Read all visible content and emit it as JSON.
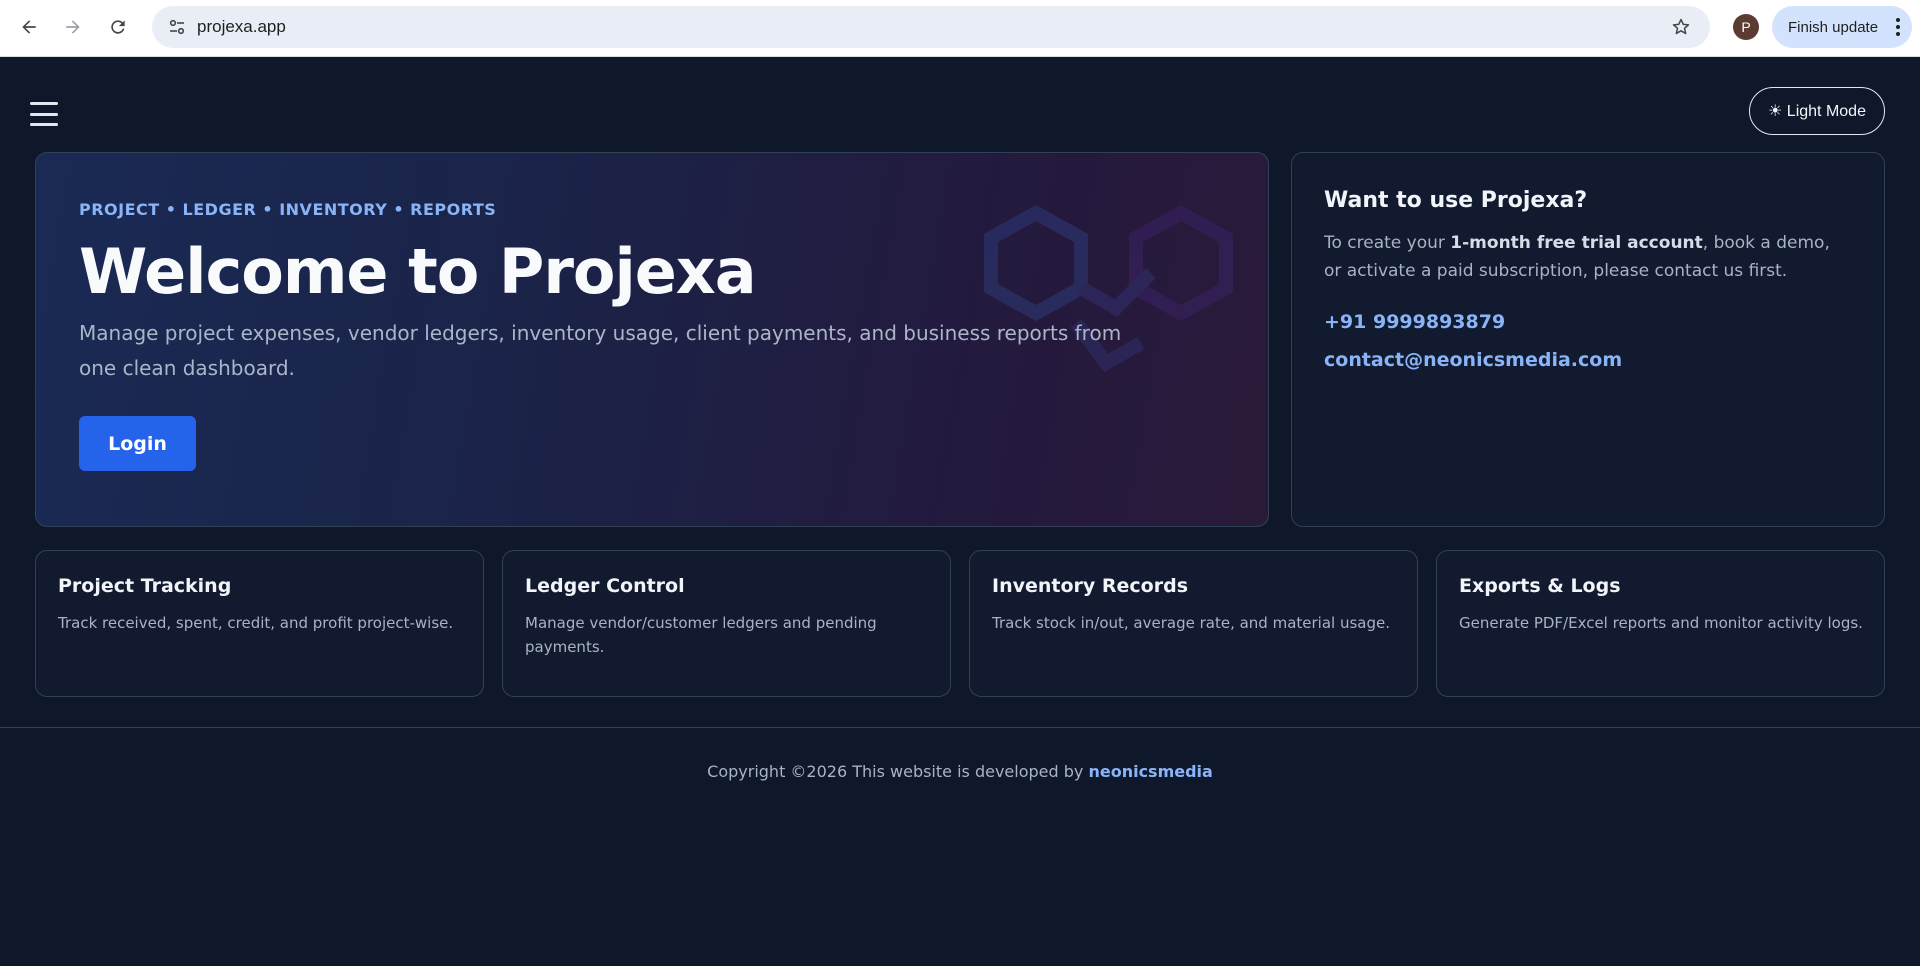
{
  "browser": {
    "url": "projexa.app",
    "profile_initial": "P",
    "update_label": "Finish update"
  },
  "header": {
    "mode_toggle_label": "☀ Light Mode"
  },
  "hero": {
    "eyebrow": "PROJECT • LEDGER • INVENTORY • REPORTS",
    "title": "Welcome to Projexa",
    "description": "Manage project expenses, vendor ledgers, inventory usage, client payments, and business reports from one clean dashboard.",
    "login_label": "Login"
  },
  "contact": {
    "title": "Want to use Projexa?",
    "text_before": "To create your ",
    "text_bold": "1-month free trial account",
    "text_after": ", book a demo, or activate a paid subscription, please contact us first.",
    "phone": "+91 9999893879",
    "email": "contact@neonicsmedia.com"
  },
  "features": [
    {
      "title": "Project Tracking",
      "description": "Track received, spent, credit, and profit project-wise."
    },
    {
      "title": "Ledger Control",
      "description": "Manage vendor/customer ledgers and pending payments."
    },
    {
      "title": "Inventory Records",
      "description": "Track stock in/out, average rate, and material usage."
    },
    {
      "title": "Exports & Logs",
      "description": "Generate PDF/Excel reports and monitor activity logs."
    }
  ],
  "footer": {
    "text": "Copyright ©2026 This website is developed by ",
    "brand": "neonicsmedia"
  },
  "colors": {
    "background": "#0f172a",
    "accent": "#2563eb",
    "link": "#8ab4f8"
  }
}
